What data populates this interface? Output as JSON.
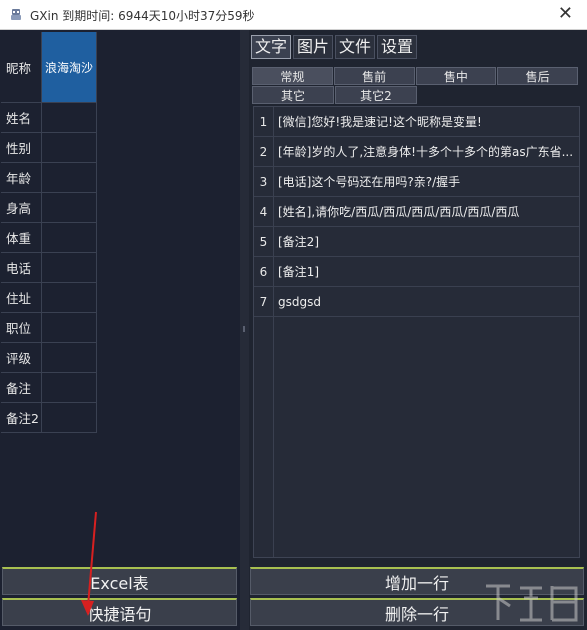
{
  "titlebar": {
    "app_name": "GXin",
    "expiry_label": "到期时间:",
    "expiry_value": "6944天10小时37分59秒",
    "close_glyph": "✕"
  },
  "profile": {
    "rows": [
      {
        "label": "昵称",
        "value": "浪海淘沙"
      },
      {
        "label": "姓名",
        "value": ""
      },
      {
        "label": "性别",
        "value": ""
      },
      {
        "label": "年龄",
        "value": ""
      },
      {
        "label": "身高",
        "value": ""
      },
      {
        "label": "体重",
        "value": ""
      },
      {
        "label": "电话",
        "value": ""
      },
      {
        "label": "住址",
        "value": ""
      },
      {
        "label": "职位",
        "value": ""
      },
      {
        "label": "评级",
        "value": ""
      },
      {
        "label": "备注",
        "value": ""
      },
      {
        "label": "备注2",
        "value": ""
      }
    ]
  },
  "main_tabs": [
    "文字",
    "图片",
    "文件",
    "设置"
  ],
  "sub_tabs": [
    "常规",
    "售前",
    "售中",
    "售后",
    "其它",
    "其它2"
  ],
  "phrases": [
    {
      "num": "1",
      "text": "[微信]您好!我是速记!这个昵称是变量!"
    },
    {
      "num": "2",
      "text": "[年龄]岁的人了,注意身体!十多个十多个的第as广东省..."
    },
    {
      "num": "3",
      "text": "[电话]这个号码还在用吗?亲?/握手"
    },
    {
      "num": "4",
      "text": "[姓名],请你吃/西瓜/西瓜/西瓜/西瓜/西瓜/西瓜"
    },
    {
      "num": "5",
      "text": "[备注2]"
    },
    {
      "num": "6",
      "text": "[备注1]"
    },
    {
      "num": "7",
      "text": "gsdgsd"
    }
  ],
  "buttons": {
    "excel": "Excel表",
    "quick_phrases": "快捷语句",
    "add_row": "增加一行",
    "delete_row": "删除一行"
  },
  "watermark": "下载吧",
  "colors": {
    "background": "#1f2430",
    "selected_cell": "#1f5fa0",
    "button_accent": "#a8c050",
    "annotation_arrow": "#d62020"
  },
  "icons": {
    "app": "bot-icon",
    "close": "close-icon"
  }
}
